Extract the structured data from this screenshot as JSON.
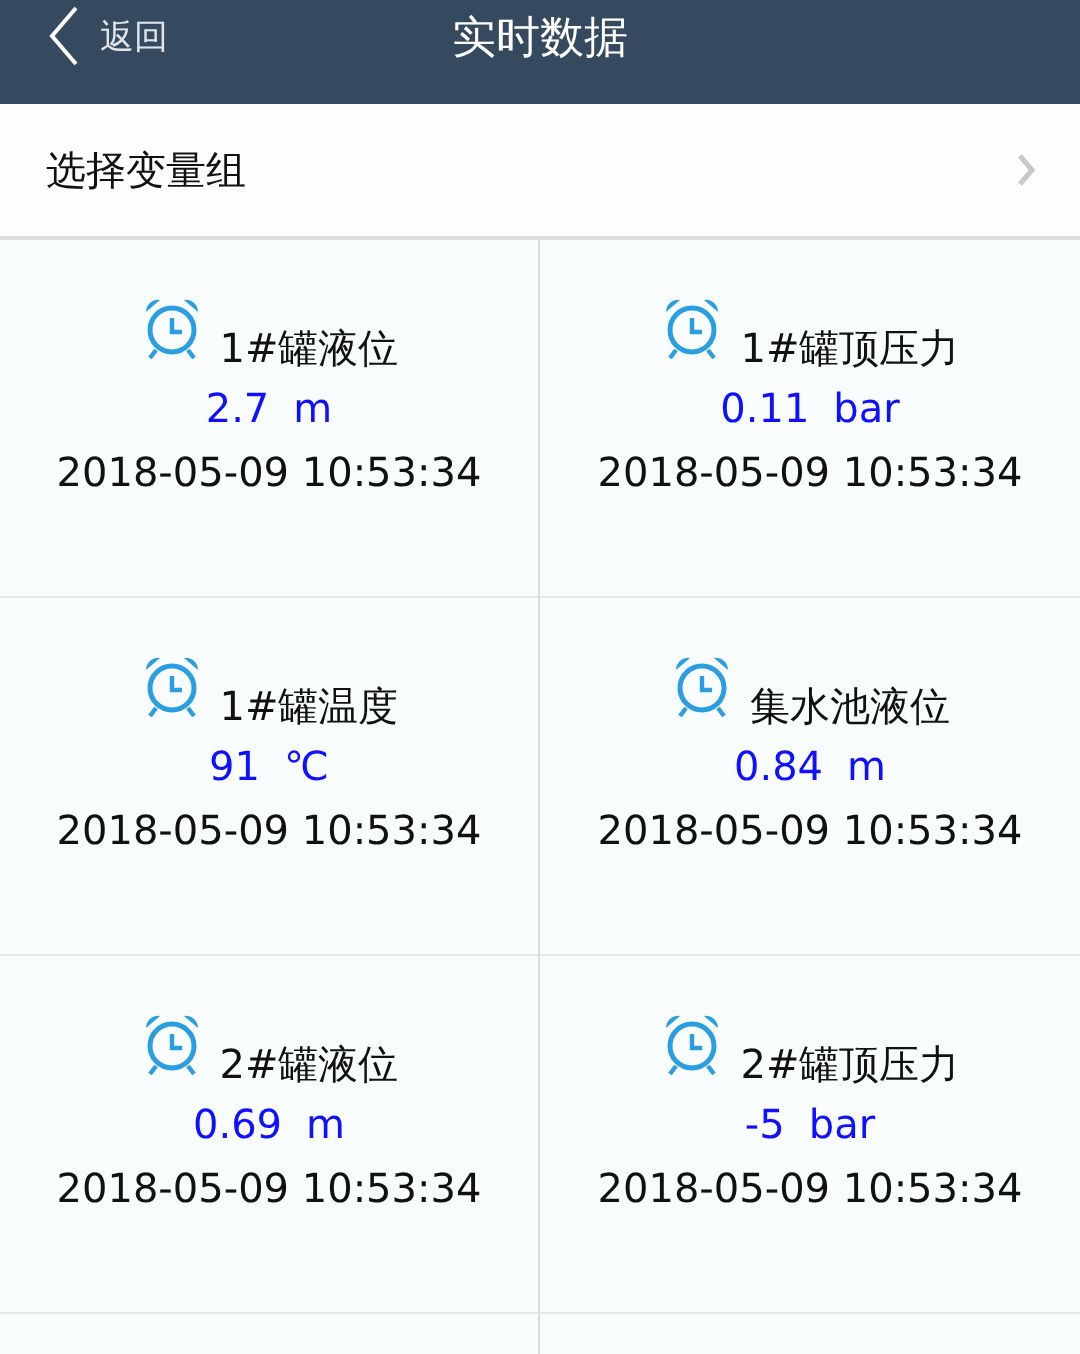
{
  "header": {
    "back_label": "返回",
    "title": "实时数据"
  },
  "group_selector": {
    "label": "选择变量组"
  },
  "tiles": [
    {
      "name": "1#罐液位",
      "value": "2.7",
      "unit": "m",
      "timestamp": "2018-05-09 10:53:34"
    },
    {
      "name": "1#罐顶压力",
      "value": "0.11",
      "unit": "bar",
      "timestamp": "2018-05-09 10:53:34"
    },
    {
      "name": "1#罐温度",
      "value": "91",
      "unit": "℃",
      "timestamp": "2018-05-09 10:53:34"
    },
    {
      "name": "集水池液位",
      "value": "0.84",
      "unit": "m",
      "timestamp": "2018-05-09 10:53:34"
    },
    {
      "name": "2#罐液位",
      "value": "0.69",
      "unit": "m",
      "timestamp": "2018-05-09 10:53:34"
    },
    {
      "name": "2#罐顶压力",
      "value": "-5",
      "unit": "bar",
      "timestamp": "2018-05-09 10:53:34"
    }
  ]
}
